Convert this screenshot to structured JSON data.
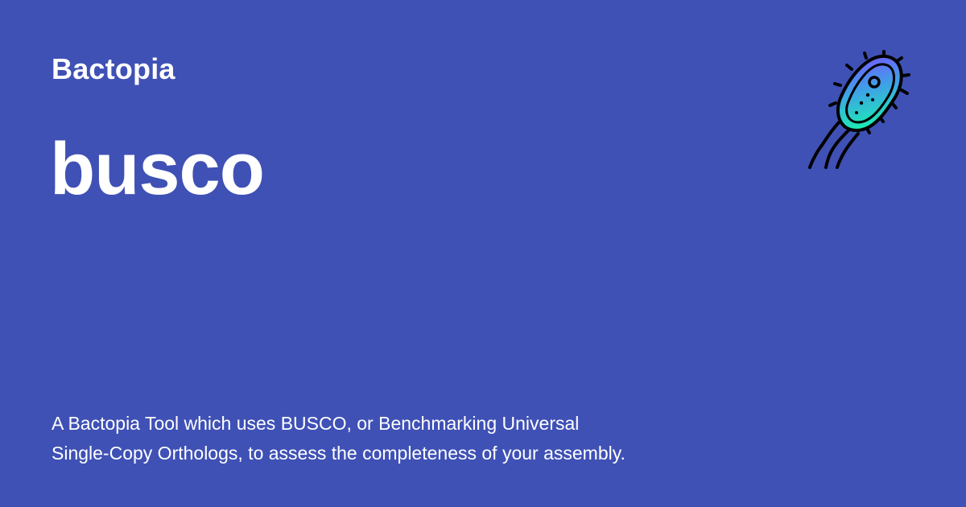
{
  "site_name": "Bactopia",
  "tool_name": "busco",
  "description_lines": [
    "A Bactopia Tool which uses BUSCO, or Benchmarking Universal",
    "Single-Copy Orthologs, to assess the completeness of your assembly."
  ],
  "logo_icon": "bacterium-icon",
  "colors": {
    "background": "#3f51b5",
    "text": "#ffffff",
    "logo_gradient_top": "#7c4dff",
    "logo_gradient_bottom": "#1de9b6",
    "logo_outline": "#000000"
  }
}
